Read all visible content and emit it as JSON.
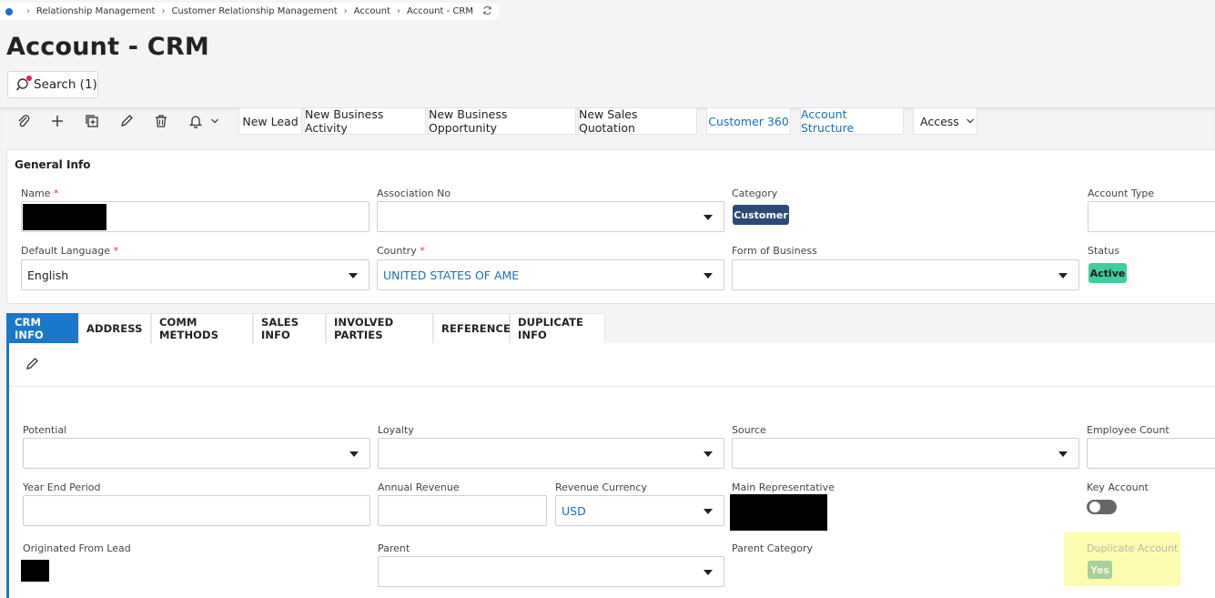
{
  "breadcrumb": {
    "items": [
      "Relationship Management",
      "Customer Relationship Management",
      "Account",
      "Account - CRM"
    ]
  },
  "page": {
    "title": "Account - CRM"
  },
  "search": {
    "label": "Search (1)"
  },
  "toolbar": {
    "buttons": [
      "New Lead",
      "New Business Activity",
      "New Business Opportunity",
      "New Sales Quotation",
      "Customer 360",
      "Account Structure",
      "Access"
    ]
  },
  "general_info": {
    "title": "General Info",
    "name_label": "Name",
    "association_label": "Association No",
    "category_label": "Category",
    "category_value": "Customer",
    "account_type_label": "Account Type",
    "default_language_label": "Default Language",
    "default_language_value": "English",
    "country_label": "Country",
    "country_value": "UNITED STATES OF AME",
    "form_of_business_label": "Form of Business",
    "status_label": "Status",
    "status_value": "Active",
    "required_mark": "*"
  },
  "tabs": [
    "CRM INFO",
    "ADDRESS",
    "COMM METHODS",
    "SALES INFO",
    "INVOLVED PARTIES",
    "REFERENCES",
    "DUPLICATE INFO"
  ],
  "crm_info": {
    "potential_label": "Potential",
    "loyalty_label": "Loyalty",
    "source_label": "Source",
    "employee_count_label": "Employee Count",
    "year_end_label": "Year End Period",
    "annual_revenue_label": "Annual Revenue",
    "revenue_currency_label": "Revenue Currency",
    "revenue_currency_value": "USD",
    "main_rep_label": "Main Representative",
    "key_account_label": "Key Account",
    "originated_label": "Originated From Lead",
    "parent_label": "Parent",
    "parent_category_label": "Parent Category",
    "duplicate_label": "Duplicate Account",
    "duplicate_value": "Yes"
  },
  "colors": {
    "accent": "#1b77c9",
    "category_badge": "#2b4a78",
    "status_badge": "#3fcf9c",
    "highlight": "#fcfcb0"
  }
}
